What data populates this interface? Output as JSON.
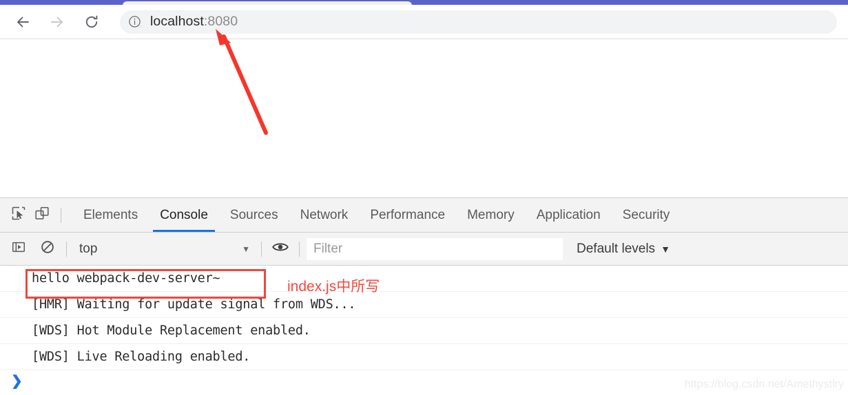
{
  "browser": {
    "nav": {
      "back_label": "Back",
      "forward_label": "Forward",
      "reload_label": "Reload"
    },
    "omnibox": {
      "info_icon": "info-circle-icon",
      "url_host": "localhost",
      "url_port": ":8080",
      "full_url": "localhost:8080"
    },
    "tabstrip_color": "#5c63c8"
  },
  "devtools": {
    "toolbar_icons": {
      "inspect": "inspect-element-icon",
      "device": "device-toolbar-icon"
    },
    "tabs": [
      {
        "label": "Elements",
        "active": false
      },
      {
        "label": "Console",
        "active": true
      },
      {
        "label": "Sources",
        "active": false
      },
      {
        "label": "Network",
        "active": false
      },
      {
        "label": "Performance",
        "active": false
      },
      {
        "label": "Memory",
        "active": false
      },
      {
        "label": "Application",
        "active": false
      },
      {
        "label": "Security",
        "active": false
      }
    ],
    "active_tab": "Console",
    "active_tab_color": "#1a73e8",
    "console_toolbar": {
      "sidebar_icon": "console-sidebar-icon",
      "clear_icon": "clear-console-icon",
      "context": "top",
      "context_caret": "▼",
      "eye_icon": "live-expression-eye-icon",
      "filter_value": "",
      "filter_placeholder": "Filter",
      "levels_label": "Default levels",
      "levels_caret": "▼"
    },
    "messages": [
      {
        "text": "hello webpack-dev-server~",
        "highlighted": true
      },
      {
        "text": "[HMR] Waiting for update signal from WDS...",
        "highlighted": false
      },
      {
        "text": "[WDS] Hot Module Replacement enabled.",
        "highlighted": false
      },
      {
        "text": "[WDS] Live Reloading enabled.",
        "highlighted": false
      }
    ],
    "prompt": {
      "caret": "❯",
      "value": ""
    }
  },
  "annotations": {
    "note_text": "index.js中所写",
    "note_color": "#f4483f",
    "box_color": "#f4453c",
    "arrow_color": "#f4372c",
    "watermark": "https://blog.csdn.net/Amethystlry"
  }
}
